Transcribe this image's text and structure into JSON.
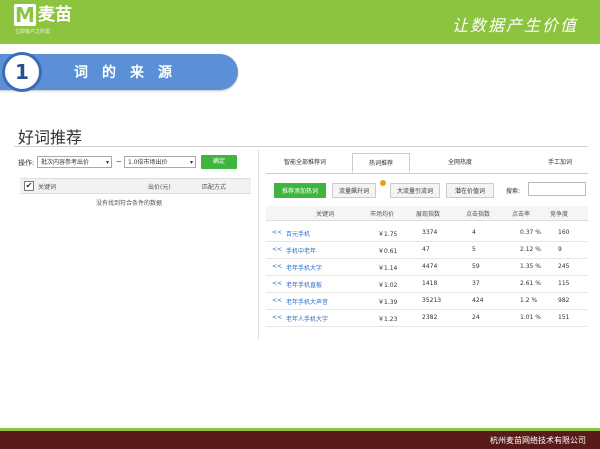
{
  "brand": {
    "logo_letter": "M",
    "logo_name": "麦苗",
    "logo_sub": "立即客户之所需",
    "slogan": "让数据产生价值"
  },
  "section": {
    "number": "1",
    "title": "词的来源"
  },
  "page_title": "好词推荐",
  "left_panel": {
    "op_label": "操作:",
    "select1": "批次内容参考出价",
    "tilde": "~",
    "select2": "1.0倍市场出价",
    "confirm": "确定",
    "columns": [
      "关键词",
      "出价(元)",
      "匹配方式"
    ],
    "no_data": "没有找到符合条件的数据"
  },
  "right_panel": {
    "tabs": [
      "智能全部推荐词",
      "热词推荐",
      "全网热度",
      "手工加词"
    ],
    "active_tab": 1,
    "subtabs": [
      "推荐添加热词",
      "流量飙升词",
      "大流量引流词",
      "潜在价值词"
    ],
    "search_label": "搜索:",
    "columns": [
      "关键词",
      "市场均价",
      "展现指数",
      "点击指数",
      "点击率",
      "竞争度"
    ],
    "rows": [
      {
        "keyword": "百元手机",
        "price": "￥1.75",
        "impressions": "3374",
        "clicks": "4",
        "ctr": "0.37 %",
        "competition": "160"
      },
      {
        "keyword": "手机中老年",
        "price": "￥0.61",
        "impressions": "47",
        "clicks": "5",
        "ctr": "2.12 %",
        "competition": "9"
      },
      {
        "keyword": "老年手机大字",
        "price": "￥1.14",
        "impressions": "4474",
        "clicks": "59",
        "ctr": "1.35 %",
        "competition": "245"
      },
      {
        "keyword": "老年手机直板",
        "price": "￥1.02",
        "impressions": "1418",
        "clicks": "37",
        "ctr": "2.61 %",
        "competition": "115"
      },
      {
        "keyword": "老年手机大声音",
        "price": "￥1.39",
        "impressions": "35213",
        "clicks": "424",
        "ctr": "1.2 %",
        "competition": "982"
      },
      {
        "keyword": "老年人手机大字",
        "price": "￥1.23",
        "impressions": "2382",
        "clicks": "24",
        "ctr": "1.01 %",
        "competition": "151"
      }
    ],
    "row_prefix": "<<"
  },
  "footer": {
    "company": "杭州麦苗网络技术有限公司"
  },
  "colors": {
    "brand_green": "#8cc43f",
    "banner_blue": "#5b8fd6",
    "button_green": "#3fb43f",
    "footer": "#5a1a1a"
  }
}
